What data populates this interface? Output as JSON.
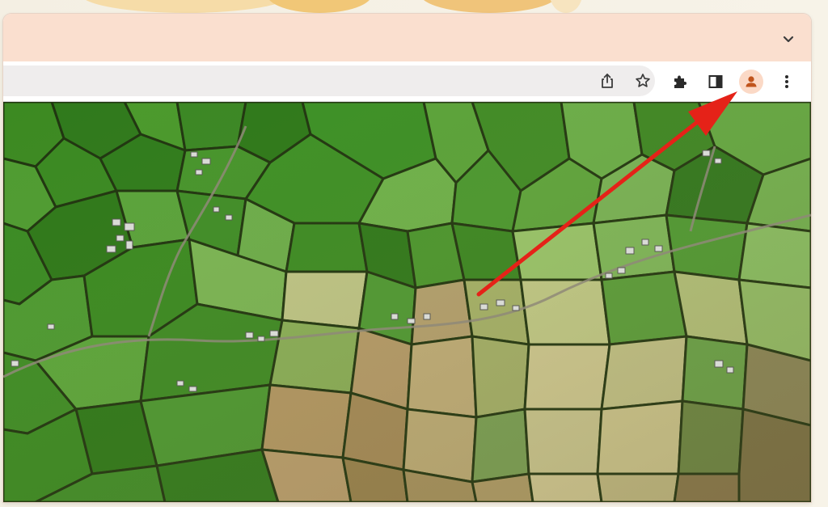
{
  "browser": {
    "tab_strip": {
      "chevron_icon": "chevron-down-icon"
    },
    "omnibox": {
      "value": "",
      "placeholder": ""
    },
    "toolbar_icons": {
      "share": "share-icon",
      "bookmark": "star-icon",
      "extensions": "puzzle-icon",
      "side_panel": "side-panel-icon",
      "profile": "profile-avatar-icon",
      "menu": "kebab-menu-icon"
    }
  },
  "page": {
    "content": "satellite-aerial-farmland-image"
  },
  "annotation": {
    "type": "red-arrow",
    "points_to": "profile-avatar-icon",
    "color": "#e52218"
  },
  "colors": {
    "tab_strip_bg": "#fadfcf",
    "omnibox_bg": "#efeded",
    "profile_bg": "#fbd9c6",
    "profile_fg": "#c0541c",
    "icon": "#3c3c3c"
  }
}
